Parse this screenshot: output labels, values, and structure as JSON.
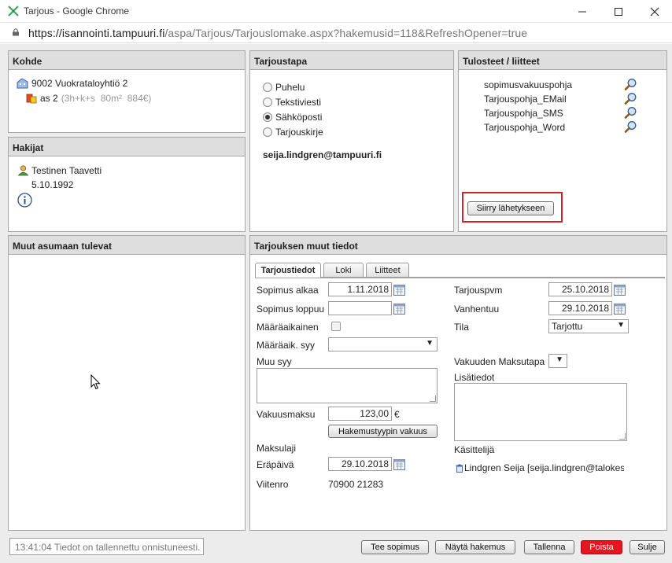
{
  "window": {
    "title": "Tarjous - Google Chrome",
    "url_host": "https://isannointi.tampuuri.fi",
    "url_path": "/aspa/Tarjous/Tarjouslomake.aspx?hakemusid=118&RefreshOpener=true"
  },
  "kohde": {
    "header": "Kohde",
    "property": "9002 Vuokrataloyhtiö 2",
    "apartment": "as 2",
    "apartment_details": "(3h+k+s  80m²  884€)"
  },
  "hakijat": {
    "header": "Hakijat",
    "name": "Testinen Taavetti",
    "date": "5.10.1992"
  },
  "tarjoustapa": {
    "header": "Tarjoustapa",
    "options": [
      {
        "label": "Puhelu",
        "checked": false
      },
      {
        "label": "Tekstiviesti",
        "checked": false
      },
      {
        "label": "Sähköposti",
        "checked": true
      },
      {
        "label": "Tarjouskirje",
        "checked": false
      }
    ],
    "email": "seija.lindgren@tampuuri.fi"
  },
  "tulosteet": {
    "header": "Tulosteet / liitteet",
    "items": [
      "sopimusvakuuspohja",
      "Tarjouspohja_EMail",
      "Tarjouspohja_SMS",
      "Tarjouspohja_Word"
    ],
    "send_button": "Siirry lähetykseen"
  },
  "muut": {
    "header": "Muut asumaan tulevat"
  },
  "details": {
    "header": "Tarjouksen muut tiedot",
    "tabs": [
      "Tarjoustiedot",
      "Loki",
      "Liitteet"
    ],
    "left": {
      "sopimus_alkaa_label": "Sopimus alkaa",
      "sopimus_alkaa_value": "1.11.2018",
      "sopimus_loppuu_label": "Sopimus loppuu",
      "sopimus_loppuu_value": "",
      "maaraaikainen_label": "Määräaikainen",
      "maaraaik_syy_label": "Määräaik. syy",
      "maaraaik_syy_value": "",
      "muu_syy_label": "Muu syy",
      "vakuusmaksu_label": "Vakuusmaksu",
      "vakuusmaksu_value": "123,00",
      "vakuusmaksu_unit": "€",
      "hakemustyyppi_button": "Hakemustyypin vakuus",
      "maksulaji_label": "Maksulaji",
      "erapaiva_label": "Eräpäivä",
      "erapaiva_value": "29.10.2018",
      "viitenro_label": "Viitenro",
      "viitenro_value": "70900 21283"
    },
    "right": {
      "tarjouspvm_label": "Tarjouspvm",
      "tarjouspvm_value": "25.10.2018",
      "vanhentuu_label": "Vanhentuu",
      "vanhentuu_value": "29.10.2018",
      "tila_label": "Tila",
      "tila_value": "Tarjottu",
      "vakuuden_maksutapa_label": "Vakuuden Maksutapa",
      "lisatiedot_label": "Lisätiedot",
      "kasittelija_label": "Käsittelijä",
      "kasittelija_value": "Lindgren Seija [seija.lindgren@talokes"
    }
  },
  "footer": {
    "status": "13:41:04 Tiedot on tallennettu onnistuneesti.",
    "buttons": {
      "tee_sopimus": "Tee sopimus",
      "nayta_hakemus": "Näytä hakemus",
      "tallenna": "Tallenna",
      "poista": "Poista",
      "sulje": "Sulje"
    }
  },
  "colors": {
    "highlight_border": "#d0242a",
    "delete_button": "#e8141f"
  }
}
